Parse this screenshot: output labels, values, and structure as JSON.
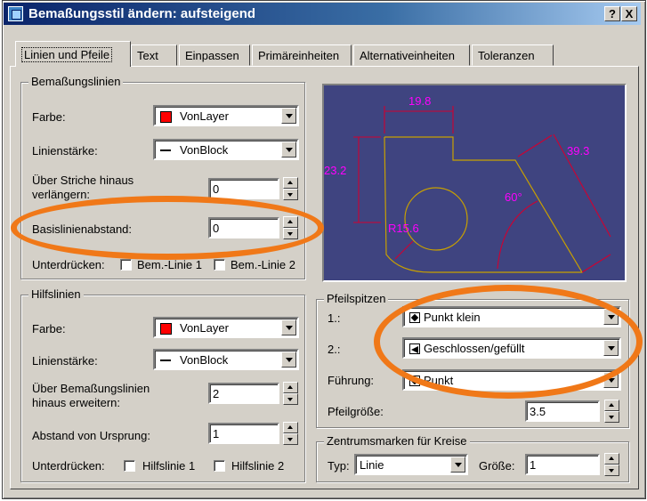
{
  "window": {
    "title": "Bemaßungsstil ändern: aufsteigend"
  },
  "title_buttons": {
    "help": "?",
    "close": "X"
  },
  "tabs": [
    "Linien und Pfeile",
    "Text",
    "Einpassen",
    "Primäreinheiten",
    "Alternativeinheiten",
    "Toleranzen"
  ],
  "dim_lines": {
    "title": "Bemaßungslinien",
    "color_label": "Farbe:",
    "color_value": "VonLayer",
    "lineweight_label": "Linienstärke:",
    "lineweight_value": "VonBlock",
    "extend_label_1": "Über Striche hinaus",
    "extend_label_2": "verlängern:",
    "extend_value": "0",
    "baseline_label": "Basislinienabstand:",
    "baseline_value": "0",
    "suppress_label": "Unterdrücken:",
    "suppress_1": "Bem.-Linie 1",
    "suppress_2": "Bem.-Linie 2"
  },
  "ext_lines": {
    "title": "Hilfslinien",
    "color_label": "Farbe:",
    "color_value": "VonLayer",
    "lineweight_label": "Linienstärke:",
    "lineweight_value": "VonBlock",
    "extend_label_1": "Über Bemaßungslinien",
    "extend_label_2": "hinaus erweitern:",
    "extend_value": "2",
    "offset_label": "Abstand von Ursprung:",
    "offset_value": "1",
    "suppress_label": "Unterdrücken:",
    "suppress_1": "Hilfslinie 1",
    "suppress_2": "Hilfslinie 2"
  },
  "arrowheads": {
    "title": "Pfeilspitzen",
    "first_label": "1.:",
    "first_value": "Punkt klein",
    "second_label": "2.:",
    "second_value": "Geschlossen/gefüllt",
    "leader_label": "Führung:",
    "leader_value": "Punkt",
    "size_label": "Pfeilgröße:",
    "size_value": "3.5"
  },
  "center_marks": {
    "title": "Zentrumsmarken für Kreise",
    "type_label": "Typ:",
    "type_value": "Linie",
    "size_label": "Größe:",
    "size_value": "1"
  },
  "preview": {
    "dim_top": "19.8",
    "dim_left": "23.2",
    "dim_right": "39.3",
    "dim_angle": "60°",
    "dim_radius": "R15.6"
  },
  "colors": {
    "preview_background": "#3f4480",
    "dimension_color": "#ff00ff",
    "dimension_line_color": "#d00030",
    "geometry_color": "#c8a000",
    "highlight_oval": "#f07818",
    "titlebar": "#0a246a"
  }
}
